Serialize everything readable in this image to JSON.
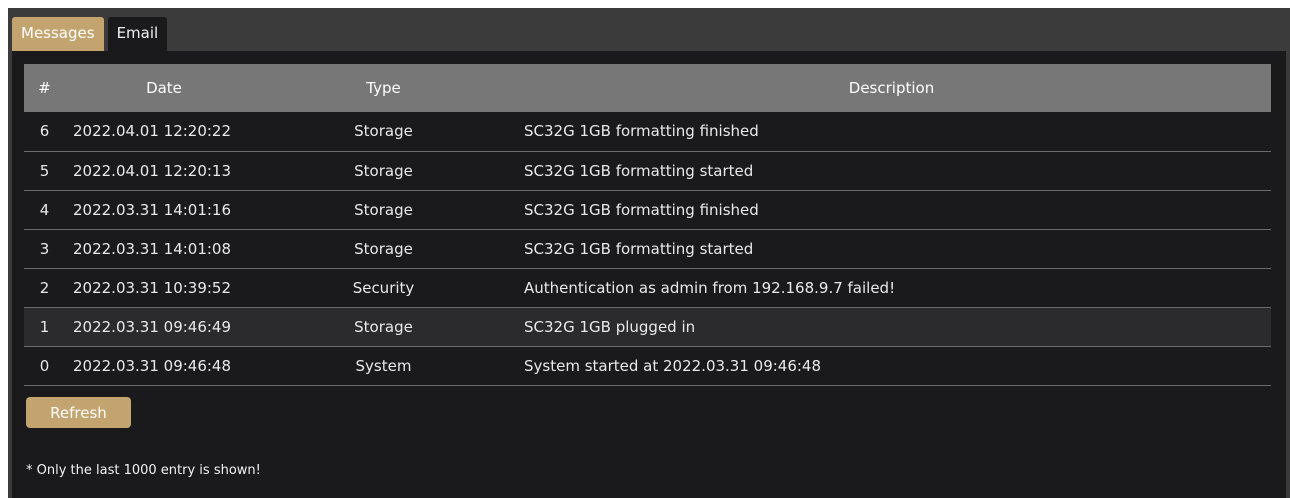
{
  "tabs": [
    {
      "label": "Messages",
      "active": true
    },
    {
      "label": "Email",
      "active": false
    }
  ],
  "table": {
    "headers": {
      "num": "#",
      "date": "Date",
      "type": "Type",
      "description": "Description"
    },
    "rows": [
      {
        "num": "6",
        "date": "2022.04.01 12:20:22",
        "type": "Storage",
        "description": "SC32G 1GB formatting finished"
      },
      {
        "num": "5",
        "date": "2022.04.01 12:20:13",
        "type": "Storage",
        "description": "SC32G 1GB formatting started"
      },
      {
        "num": "4",
        "date": "2022.03.31 14:01:16",
        "type": "Storage",
        "description": "SC32G 1GB formatting finished"
      },
      {
        "num": "3",
        "date": "2022.03.31 14:01:08",
        "type": "Storage",
        "description": "SC32G 1GB formatting started"
      },
      {
        "num": "2",
        "date": "2022.03.31 10:39:52",
        "type": "Security",
        "description": "Authentication as admin from 192.168.9.7 failed!"
      },
      {
        "num": "1",
        "date": "2022.03.31 09:46:49",
        "type": "Storage",
        "description": "SC32G 1GB plugged in"
      },
      {
        "num": "0",
        "date": "2022.03.31 09:46:48",
        "type": "System",
        "description": "System started at 2022.03.31 09:46:48"
      }
    ]
  },
  "refresh_label": "Refresh",
  "note": "* Only the last 1000 entry is shown!",
  "colors": {
    "accent": "#c4a46e",
    "panel": "#1a1a1d",
    "header": "#777777"
  }
}
